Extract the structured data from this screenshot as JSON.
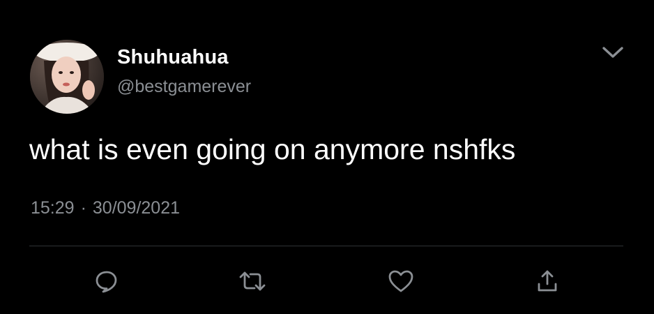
{
  "tweet": {
    "display_name": "Shuhuahua",
    "handle": "@bestgamerever",
    "text": "what is even going on anymore nshfks",
    "time": "15:29",
    "separator": "·",
    "date": "30/09/2021"
  },
  "icons": {
    "menu": "chevron-down-icon",
    "reply": "reply-icon",
    "retweet": "retweet-icon",
    "like": "heart-icon",
    "share": "share-icon"
  },
  "colors": {
    "background": "#000000",
    "primary_text": "#ffffff",
    "secondary_text": "#8b8f94",
    "divider": "#2f3336",
    "icon": "#8b8f94"
  }
}
